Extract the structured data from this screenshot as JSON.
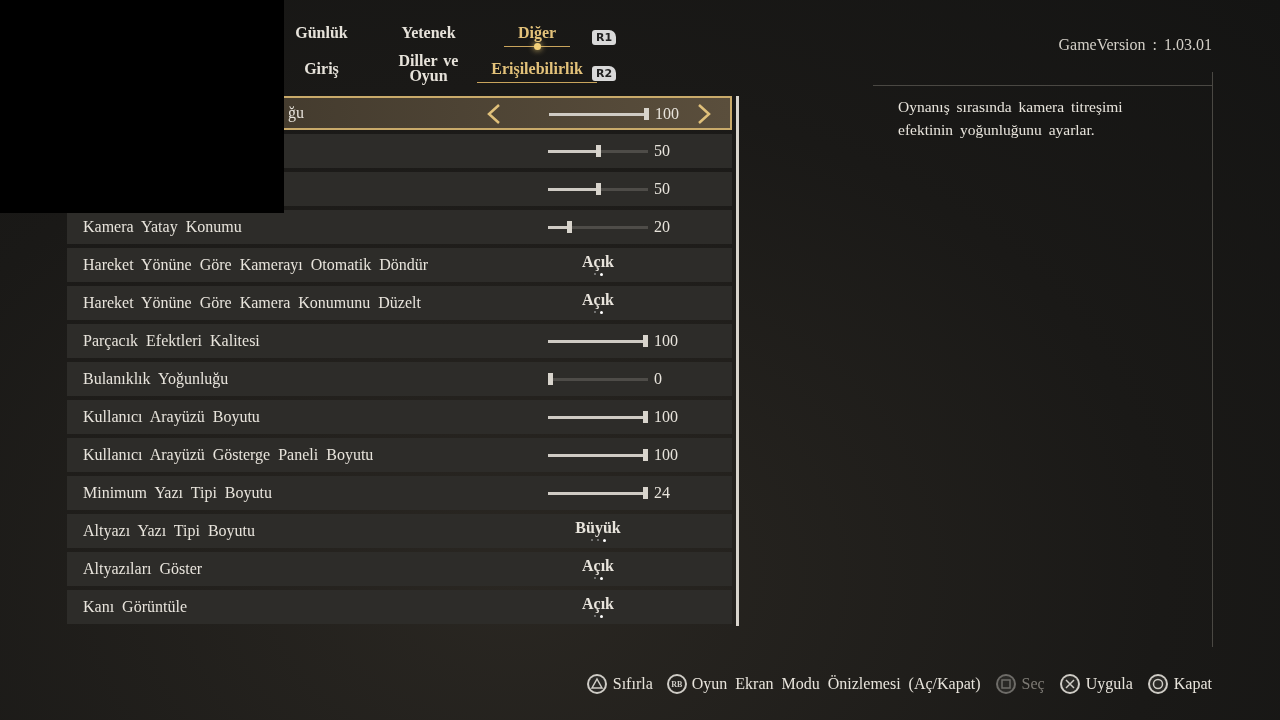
{
  "tabs": [
    {
      "label": "Günlük",
      "selected": false
    },
    {
      "label": "Yetenek",
      "selected": false
    },
    {
      "label": "Diğer",
      "selected": true
    }
  ],
  "tabs_button": "R1",
  "subtabs": [
    {
      "label": "Giriş",
      "selected": false
    },
    {
      "label": "Diller ve Oyun",
      "selected": false
    },
    {
      "label": "Erişilebilirlik",
      "selected": true
    }
  ],
  "subtabs_button": "R2",
  "game_version": "GameVersion : 1.03.01",
  "settings": [
    {
      "kind": "slider",
      "label": "ğu",
      "label_partial": true,
      "selected": true,
      "level": 1,
      "value": "100"
    },
    {
      "kind": "slider",
      "selected": false,
      "level": 0.5,
      "value": "50"
    },
    {
      "kind": "slider",
      "selected": false,
      "level": 0.5,
      "value": "50"
    },
    {
      "kind": "slider",
      "label": "Kamera Yatay Konumu",
      "selected": false,
      "level": 0.2,
      "value": "20"
    },
    {
      "kind": "choice",
      "label": "Hareket Yönüne Göre Kamerayı Otomatik Döndür",
      "selected": false,
      "value": "Açık",
      "options": [
        {
          "selected": false
        },
        {
          "selected": true
        }
      ]
    },
    {
      "kind": "choice",
      "label": "Hareket Yönüne Göre Kamera Konumunu Düzelt",
      "selected": false,
      "value": "Açık",
      "options": [
        {
          "selected": false
        },
        {
          "selected": true
        }
      ]
    },
    {
      "kind": "slider",
      "label": "Parçacık Efektleri Kalitesi",
      "selected": false,
      "level": 1,
      "value": "100"
    },
    {
      "kind": "slider",
      "label": "Bulanıklık Yoğunluğu",
      "selected": false,
      "level": 0,
      "value": "0"
    },
    {
      "kind": "slider",
      "label": "Kullanıcı Arayüzü Boyutu",
      "selected": false,
      "level": 1,
      "value": "100"
    },
    {
      "kind": "slider",
      "label": "Kullanıcı Arayüzü Gösterge Paneli Boyutu",
      "selected": false,
      "level": 1,
      "value": "100"
    },
    {
      "kind": "slider",
      "label": "Minimum Yazı Tipi Boyutu",
      "selected": false,
      "level": 1,
      "value": "24"
    },
    {
      "kind": "choice",
      "label": "Altyazı Yazı Tipi Boyutu",
      "selected": false,
      "value": "Büyük",
      "options": [
        {
          "selected": false
        },
        {
          "selected": false
        },
        {
          "selected": true
        }
      ]
    },
    {
      "kind": "choice",
      "label": "Altyazıları Göster",
      "selected": false,
      "value": "Açık",
      "options": [
        {
          "selected": false
        },
        {
          "selected": true
        }
      ]
    },
    {
      "kind": "choice",
      "label": "Kanı Görüntüle",
      "selected": false,
      "value": "Açık",
      "options": [
        {
          "selected": false
        },
        {
          "selected": true
        }
      ]
    }
  ],
  "description": "Oynanış sırasında kamera titreşimi efektinin yoğunluğunu ayarlar.",
  "hints": [
    {
      "kind": "triangle",
      "label": "Sıfırla",
      "disabled": false
    },
    {
      "kind": "rb",
      "icon_text": "RB",
      "label": "Oyun Ekran Modu Önizlemesi (Aç/Kapat)",
      "disabled": false
    },
    {
      "kind": "square",
      "label": "Seç",
      "disabled": true
    },
    {
      "kind": "cross",
      "label": "Uygula",
      "disabled": false
    },
    {
      "kind": "circle",
      "label": "Kapat",
      "disabled": false
    }
  ]
}
